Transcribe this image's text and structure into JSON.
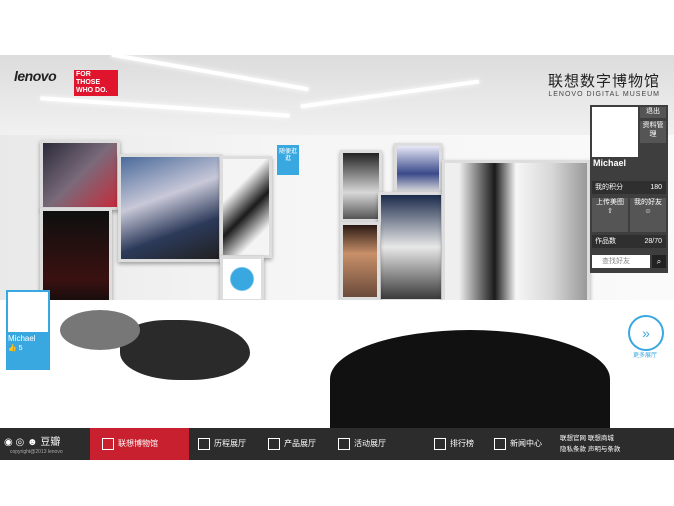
{
  "brand": {
    "logo_word": "lenovo",
    "tagline": "FOR THOSE WHO DO.",
    "museum_cn": "联想数字博物馆",
    "museum_en": "LENOVO DIGITAL MUSEUM"
  },
  "wall_sign": "随便逛逛",
  "user_card_left": {
    "name": "Michael",
    "likes": "5"
  },
  "user_panel": {
    "name": "Michael",
    "logout": "退出",
    "profile": "资料管理",
    "points_label": "我的积分",
    "points_value": "180",
    "upload_label": "上传美图",
    "friends_label": "我的好友",
    "works_label": "作品数",
    "works_value": "28/70",
    "search_placeholder": "查找好友"
  },
  "next_label": "更多展厅",
  "nav": {
    "social_name": "豆瓣",
    "copyright": "copyright@2013 lenovo",
    "items": [
      "联想博物馆",
      "历程展厅",
      "产品展厅",
      "活动展厅",
      "排行榜",
      "新闻中心"
    ],
    "links": [
      "联想官网",
      "联想商城",
      "隐私条款",
      "声明与条款"
    ]
  },
  "colors": {
    "accent": "#3aa8e0",
    "nav_active": "#c8202e",
    "navbar": "#2c2c2c"
  }
}
